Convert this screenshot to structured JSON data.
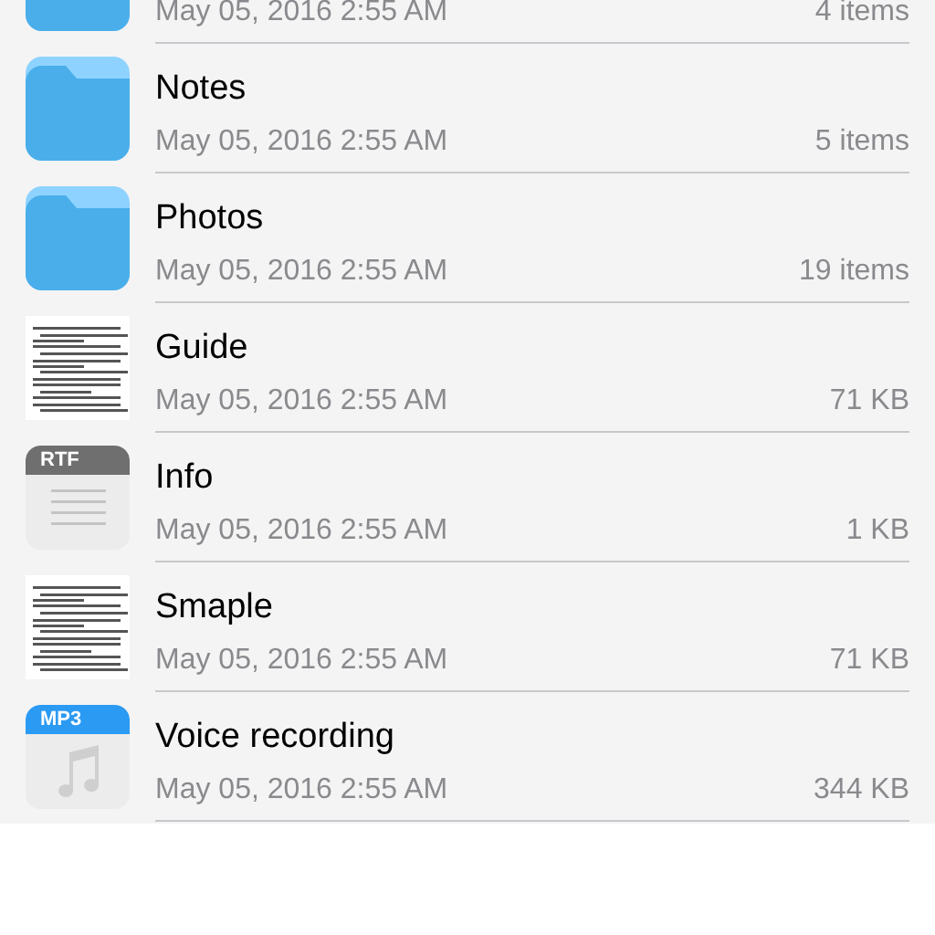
{
  "files": [
    {
      "kind": "folder",
      "date": "May 05, 2016 2:55 AM",
      "size": "4 items"
    },
    {
      "kind": "folder",
      "name": "Notes",
      "date": "May 05, 2016 2:55 AM",
      "size": "5 items"
    },
    {
      "kind": "folder",
      "name": "Photos",
      "date": "May 05, 2016 2:55 AM",
      "size": "19 items"
    },
    {
      "kind": "document",
      "name": "Guide",
      "date": "May 05, 2016 2:55 AM",
      "size": "71 KB"
    },
    {
      "kind": "rtf",
      "badge": "RTF",
      "name": "Info",
      "date": "May 05, 2016 2:55 AM",
      "size": "1 KB"
    },
    {
      "kind": "document",
      "name": "Smaple",
      "date": "May 05, 2016 2:55 AM",
      "size": "71 KB"
    },
    {
      "kind": "audio",
      "badge": "MP3",
      "name": "Voice recording",
      "date": "May 05, 2016 2:55 AM",
      "size": "344 KB"
    }
  ]
}
